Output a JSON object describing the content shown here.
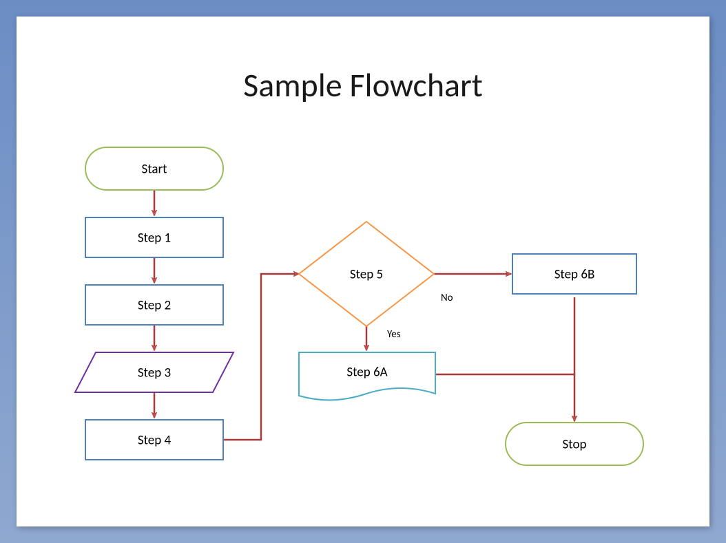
{
  "title": "Sample Flowchart",
  "nodes": {
    "start": {
      "label": "Start"
    },
    "step1": {
      "label": "Step 1"
    },
    "step2": {
      "label": "Step 2"
    },
    "step3": {
      "label": "Step 3"
    },
    "step4": {
      "label": "Step 4"
    },
    "step5": {
      "label": "Step 5"
    },
    "step6a": {
      "label": "Step 6A"
    },
    "step6b": {
      "label": "Step 6B"
    },
    "stop": {
      "label": "Stop"
    }
  },
  "edges": {
    "step5_no": {
      "label": "No"
    },
    "step5_yes": {
      "label": "Yes"
    }
  },
  "colors": {
    "terminator_border": "#9bbb59",
    "process_border": "#4f81bd",
    "data_border": "#7030a0",
    "decision_border": "#f79646",
    "document_border": "#4bacc6",
    "connector": "#a63939",
    "arrow_fill": "#c0504d"
  }
}
